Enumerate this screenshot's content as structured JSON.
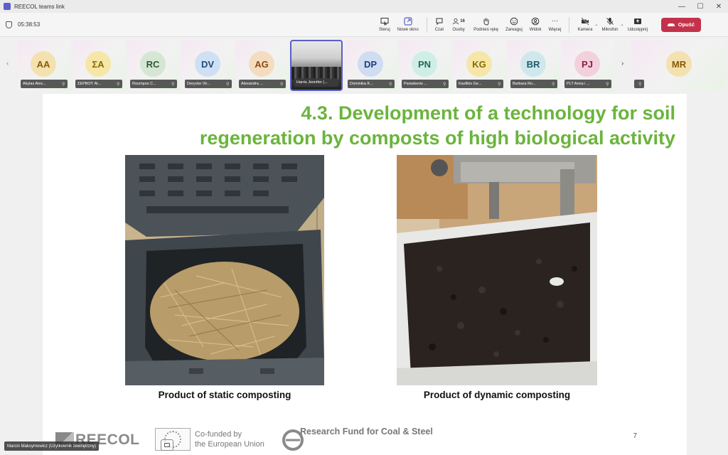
{
  "window": {
    "title": "REECOL teams link",
    "minimize": "—",
    "maximize": "☐",
    "close": "✕"
  },
  "meeting": {
    "timer": "05:38:53"
  },
  "toolbar": {
    "steruj": "Steruj",
    "nowe_okno": "Nowe okno",
    "czat": "Czat",
    "osoby": "Osoby",
    "osoby_count": "16",
    "podnies_reke": "Podnieś rękę",
    "zareaguj": "Zareaguj",
    "widok": "Widok",
    "wiecej": "Więcej",
    "kamera": "Kamera",
    "mikrofon": "Mikrofon",
    "udostepnij": "Udostępnij",
    "opusc": "Opuść"
  },
  "participants": [
    {
      "initials": "AA",
      "name": "Akylas Alex...",
      "color": "#f4e1b0",
      "text_color": "#8a5a00"
    },
    {
      "initials": "ΣA",
      "name": "ΣΕΡΒΟΥ Al...",
      "color": "#f6e6a8",
      "text_color": "#8a6a00"
    },
    {
      "initials": "RC",
      "name": "Roumpos C...",
      "color": "#d5e6d5",
      "text_color": "#2f5a2f"
    },
    {
      "initials": "DV",
      "name": "Derycke Vir...",
      "color": "#cfe0f5",
      "text_color": "#1f4a7a"
    },
    {
      "initials": "AG",
      "name": "Alexandra ...",
      "color": "#f4dcc0",
      "text_color": "#8a4a10"
    },
    {
      "initials": "",
      "name": "Harris Jennifer (...",
      "color": "",
      "text_color": ""
    },
    {
      "initials": "DP",
      "name": "Dominika K...",
      "color": "#cfdcf2",
      "text_color": "#1f3f7a"
    },
    {
      "initials": "PN",
      "name": "Paraskevis ...",
      "color": "#cfeee6",
      "text_color": "#1f6a5a"
    },
    {
      "initials": "KG",
      "name": "Kasfikis Ge...",
      "color": "#f6e6a8",
      "text_color": "#8a6a00"
    },
    {
      "initials": "BR",
      "name": "Barbara Ro...",
      "color": "#cfe8ee",
      "text_color": "#1f5a6a"
    },
    {
      "initials": "PJ",
      "name": "PLT Anna i ...",
      "color": "#f2d0dc",
      "text_color": "#8a1f3f"
    },
    {
      "initials": "MR",
      "name": "",
      "color": "#f4e1b0",
      "text_color": "#8a5a00"
    }
  ],
  "slide": {
    "title_line1": "4.3. Development of a technology for soil",
    "title_line2": "regeneration by composts of high biological activity",
    "caption_left": "Product of static composting",
    "caption_right": "Product of dynamic composting",
    "page_number": "7",
    "logo_reecol": "REECOL",
    "eu_line1": "Co-funded by",
    "eu_line2": "the European Union",
    "rfcs_text": "Research Fund for Coal & Steel",
    "title_color": "#6bb43d"
  },
  "self": {
    "name": "Marcin Maksymowicz (Użytkownik zewnętrzny)"
  }
}
